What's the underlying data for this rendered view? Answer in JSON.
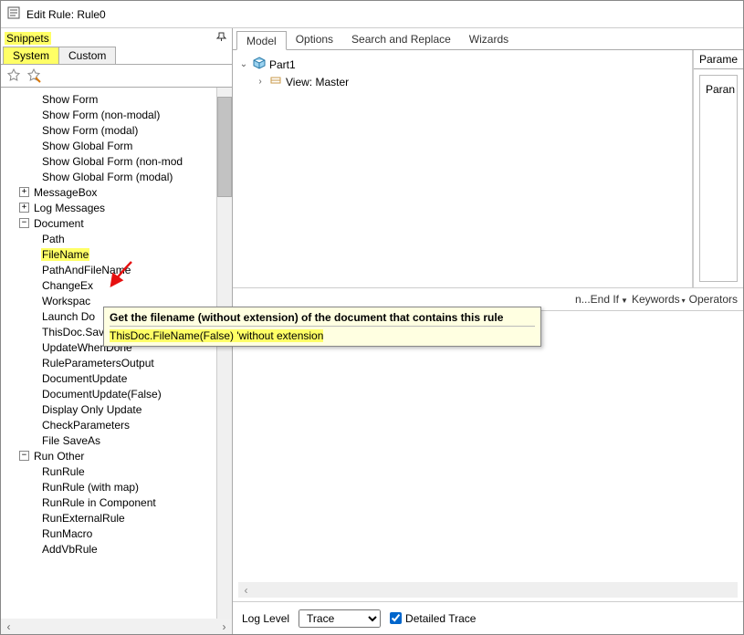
{
  "titlebar": {
    "title": "Edit Rule: Rule0"
  },
  "snippets": {
    "header_label": "Snippets",
    "tabs": {
      "system": "System",
      "custom": "Custom"
    }
  },
  "tree": {
    "l0": "Show Form",
    "l1": "Show Form (non-modal)",
    "l2": "Show Form (modal)",
    "l3": "Show Global Form",
    "l4": "Show Global Form (non-mod",
    "l5": "Show Global Form (modal)",
    "messageBox": "MessageBox",
    "logMessages": "Log Messages",
    "document": "Document",
    "doc0": "Path",
    "doc1": "FileName",
    "doc2": "PathAndFileName",
    "doc3": "ChangeEx",
    "doc4": "Workspac",
    "doc5": "Launch Do",
    "doc6": "ThisDoc.Save",
    "doc7": "UpdateWhenDone",
    "doc8": "RuleParametersOutput",
    "doc9": "DocumentUpdate",
    "doc10": "DocumentUpdate(False)",
    "doc11": "Display Only Update",
    "doc12": "CheckParameters",
    "doc13": "File SaveAs",
    "runOther": "Run Other",
    "run0": "RunRule",
    "run1": "RunRule (with map)",
    "run2": "RunRule in Component",
    "run3": "RunExternalRule",
    "run4": "RunMacro",
    "run5": "AddVbRule"
  },
  "modelTabs": {
    "model": "Model",
    "options": "Options",
    "search": "Search and Replace",
    "wizards": "Wizards"
  },
  "modelTree": {
    "part": "Part1",
    "view": "View: Master"
  },
  "paramPanel": {
    "tab": "Parame",
    "body": "Paran"
  },
  "midToolbar": {
    "endif": "n...End If",
    "keywords": "Keywords",
    "operators": "Operators"
  },
  "tooltip": {
    "title": "Get the filename (without extension) of the document that contains this rule",
    "code": "ThisDoc.FileName(False) 'without extension"
  },
  "bottomBar": {
    "logLevel": "Log Level",
    "trace": "Trace",
    "detailedTrace": "Detailed Trace"
  }
}
